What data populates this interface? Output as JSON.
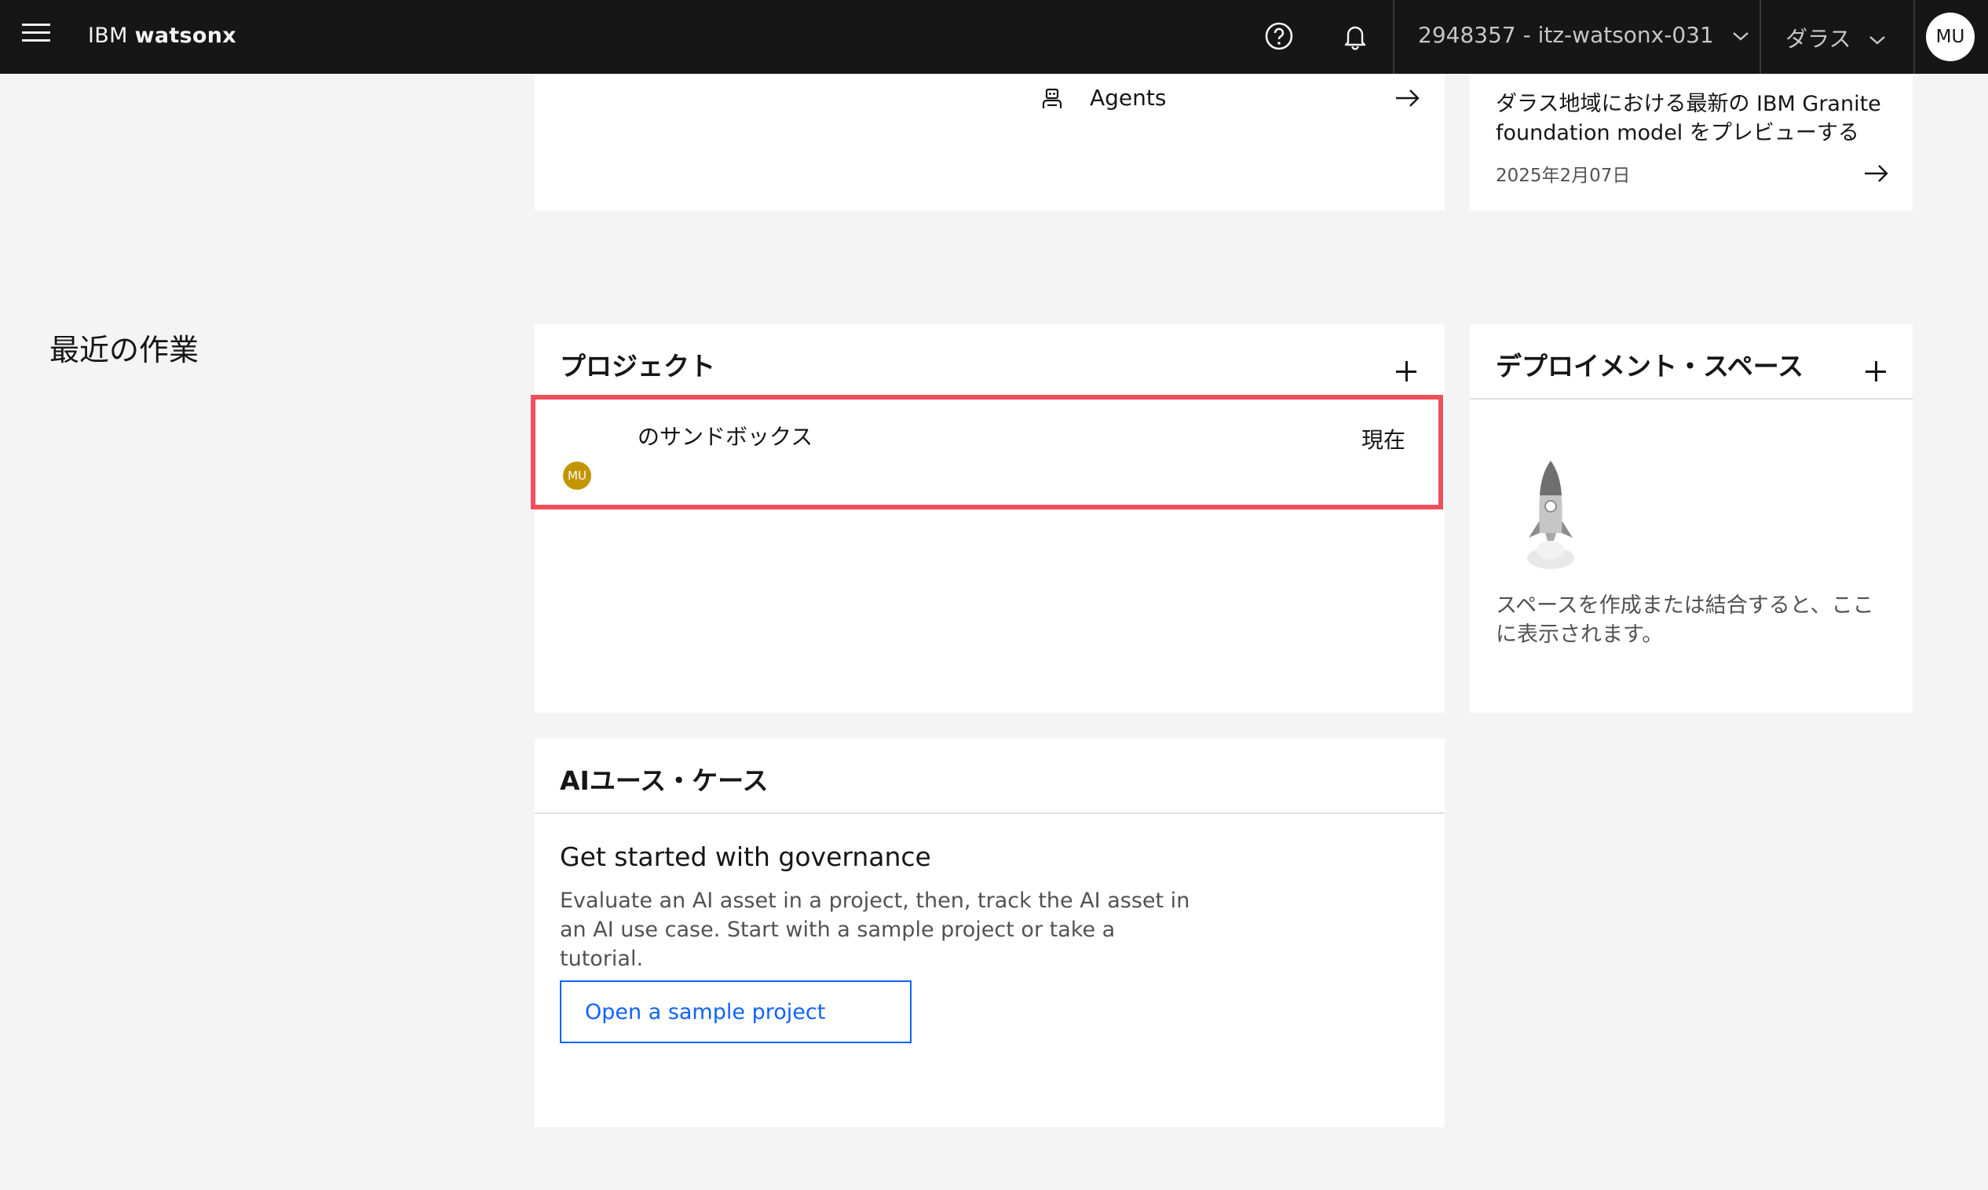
{
  "header": {
    "brand_prefix": "IBM",
    "brand_name": "watsonx",
    "account": "2948357 - itz-watsonx-031",
    "region": "ダラス",
    "user_initials": "MU"
  },
  "quick_links": {
    "agents_label": "Agents"
  },
  "news": {
    "title": "ダラス地域における最新の IBM Granite foundation model をプレビューする",
    "date": "2025年2月07日"
  },
  "recent_work": {
    "section_title": "最近の作業",
    "projects": {
      "title": "プロジェクト",
      "items": [
        {
          "name": "のサンドボックス",
          "owner_initials": "MU",
          "status": "現在"
        }
      ]
    },
    "deployment_spaces": {
      "title": "デプロイメント・スペース",
      "empty_message": "スペースを作成または結合すると、ここに表示されます。"
    },
    "ai_use_cases": {
      "title": "AIユース・ケース",
      "heading": "Get started with governance",
      "body": "Evaluate an AI asset in a project, then, track the AI asset in an AI use case. Start with a sample project or take a tutorial.",
      "button_label": "Open a sample project"
    }
  },
  "colors": {
    "top_bar": "#161616",
    "highlight_border": "#f0505b",
    "primary_blue": "#0f62fe",
    "owner_badge": "#c39600"
  }
}
